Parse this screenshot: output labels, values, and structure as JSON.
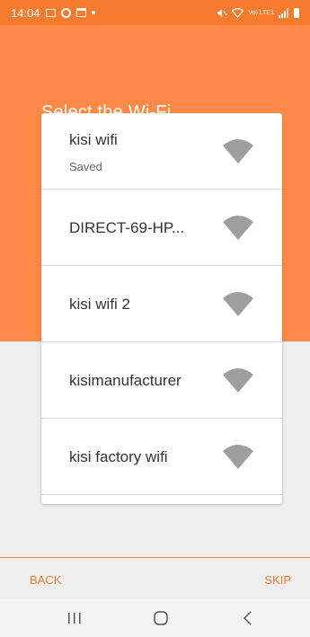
{
  "status_bar": {
    "time": "14:04",
    "network_label": "Vo) LTE1"
  },
  "page": {
    "title": "Select the Wi-Fi"
  },
  "networks": [
    {
      "name": "kisi wifi",
      "status": "Saved",
      "icon": "wifi-signal-icon"
    },
    {
      "name": "DIRECT-69-HP...",
      "status": "",
      "icon": "wifi-signal-icon"
    },
    {
      "name": "kisi wifi 2",
      "status": "",
      "icon": "wifi-signal-icon"
    },
    {
      "name": "kisimanufacturer",
      "status": "",
      "icon": "wifi-signal-icon"
    },
    {
      "name": "kisi factory wifi",
      "status": "",
      "icon": "wifi-signal-icon"
    }
  ],
  "footer": {
    "back_label": "BACK",
    "skip_label": "SKIP"
  },
  "colors": {
    "status_bar": "#f47a2e",
    "header": "#ff8a47",
    "accent": "#f47a2e",
    "wifi_icon": "#9e9e9e",
    "background": "#efefef"
  }
}
